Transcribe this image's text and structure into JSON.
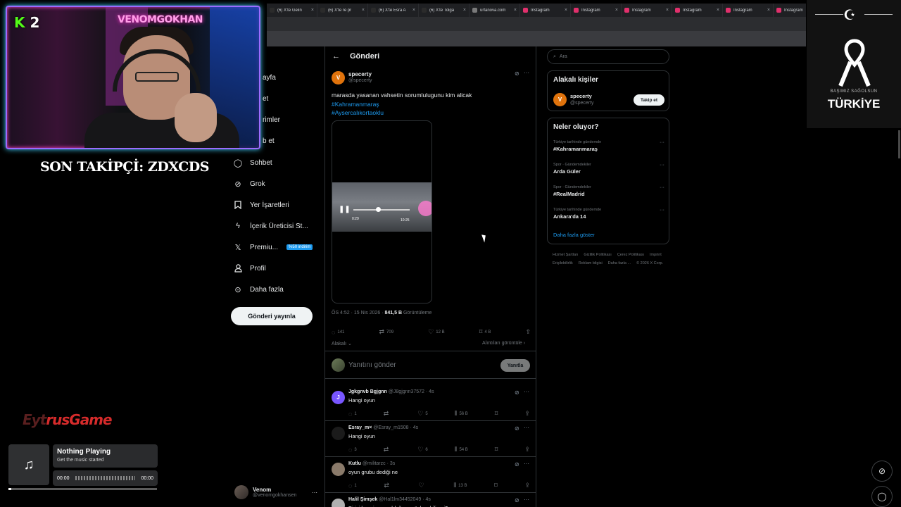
{
  "browser": {
    "tabs": [
      {
        "title": "(6) X'te Gelin",
        "color": "#2b2b2b"
      },
      {
        "title": "(6) X'te re pr",
        "color": "#2b2b2b"
      },
      {
        "title": "(6) X'te Esra A",
        "color": "#2b2b2b"
      },
      {
        "title": "(6) X'te Tolga",
        "color": "#2b2b2b"
      },
      {
        "title": "urfanova.com",
        "color": "#7a7a7a"
      },
      {
        "title": "Instagram",
        "color": "#e1306c"
      },
      {
        "title": "Instagram",
        "color": "#e1306c"
      },
      {
        "title": "Instagram",
        "color": "#e1306c"
      },
      {
        "title": "Instagram",
        "color": "#e1306c"
      },
      {
        "title": "Instagram",
        "color": "#e1306c"
      },
      {
        "title": "Instagram",
        "color": "#e1306c"
      }
    ]
  },
  "stream": {
    "cam_badge_k": "K",
    "cam_badge_num": "2",
    "cam_name": "VENOMGOKHAN",
    "last_follower": "SON TAKİPÇİ: ZDXCDS",
    "brand_logo_part1": "Eyt",
    "brand_logo_part2": "rusGame",
    "music": {
      "title": "Nothing Playing",
      "subtitle": "Get the music started",
      "time_current": "00:00",
      "time_total": "00:00",
      "progress": 0.02
    },
    "memorial": {
      "rip": "BAŞIMIZ SAĞOLSUN",
      "country": "TÜRKİYE"
    }
  },
  "nav": {
    "partial_items": [
      "ayfa",
      "et",
      "rimler",
      "b et"
    ],
    "items": [
      {
        "label": "Sohbet",
        "icon": "chat-icon"
      },
      {
        "label": "Grok",
        "icon": "grok-icon"
      },
      {
        "label": "Yer İşaretleri",
        "icon": "bookmark-icon"
      },
      {
        "label": "İçerik Üreticisi St...",
        "icon": "lightning-icon"
      },
      {
        "label": "Premiu...",
        "icon": "x-logo-icon"
      },
      {
        "label": "Profil",
        "icon": "person-icon"
      },
      {
        "label": "Daha fazla",
        "icon": "more-circle-icon"
      }
    ],
    "premium_badge": "%50 indirim",
    "post_button": "Gönderi yayınla",
    "account": {
      "name": "Venom",
      "handle": "@venomgokhansen"
    }
  },
  "main": {
    "title": "Gönderi",
    "tweet": {
      "avatar_letter": "V",
      "name": "specerty",
      "handle": "@specerty",
      "text": "marasda yasanan vahsetin sorumlulugunu kim alicak",
      "tags": [
        "#Kahramanmaraş",
        "#Aysercalıkortaoklu"
      ],
      "video_current": "0:29",
      "video_duration": "10:25",
      "time": "ÖS 4:52 · 15 Nis 2026 · ",
      "views_count": "841,5 B",
      "views_label": " Görüntüleme",
      "replies": "141",
      "reposts": "709",
      "likes": "12 B",
      "bookmarks": "4 B",
      "relevant": "Alakalı",
      "quotes": "Alıntıları görüntüle"
    },
    "reply_placeholder": "Yanıtını gönder",
    "reply_button": "Yanıtla",
    "comments": [
      {
        "avatar_letter": "J",
        "avatar_color": "#7856ff",
        "name": "Jgkgnvb Bgjgnn",
        "handle": "@J8gjgnn37572",
        "time": "4s",
        "text": "Hangi oyun",
        "replies": "1",
        "reposts": "",
        "likes": "5",
        "views": "56 B"
      },
      {
        "avatar_letter": "",
        "avatar_color": "#1b1b1b",
        "name": "Esray_m×",
        "handle": "@Esray_m1508",
        "time": "4s",
        "text": "Hangi oyun",
        "replies": "3",
        "reposts": "",
        "likes": "6",
        "views": "54 B"
      },
      {
        "avatar_letter": "",
        "avatar_color": "#8a7a6a",
        "name": "Kutlu",
        "handle": "@militarzc",
        "time": "3s",
        "text": "oyun grubu dediği ne",
        "replies": "1",
        "reposts": "",
        "likes": "",
        "views": "13 B"
      },
      {
        "avatar_letter": "",
        "avatar_color": "#b0b0b0",
        "name": "Halil Şimşek",
        "handle": "@Hal1lm34452049",
        "time": "4s",
        "text": "Birisi hangi oyun olduğunu söyleyebilir mi?",
        "replies": "",
        "reposts": "",
        "likes": "",
        "views": ""
      }
    ]
  },
  "sidebar_right": {
    "search_placeholder": "Ara",
    "people_title": "Alakalı kişiler",
    "person": {
      "avatar_letter": "V",
      "name": "specerty",
      "handle": "@specerty",
      "follow": "Takip et"
    },
    "trends_title": "Neler oluyor?",
    "trends": [
      {
        "context": "Türkiye tarihinde gündemde",
        "name": "#Kahramanmaraş"
      },
      {
        "context": "Spor · Gündemdekiler",
        "name": "Arda Güler"
      },
      {
        "context": "Spor · Gündemdekiler",
        "name": "#RealMadrid"
      },
      {
        "context": "Türkiye tarihinde gündemde",
        "name": "Ankara'da 14"
      }
    ],
    "show_more": "Daha fazla göster",
    "footer": [
      "Hizmet Şartları",
      "Gizlilik Politikası",
      "Çerez Politikası",
      "Imprint",
      "Erişilebilirlik",
      "Reklam bilgisi",
      "Daha fazla ...",
      "© 2026 X Corp."
    ]
  },
  "colors": {
    "accent": "#1d9bf0",
    "background": "#000000",
    "border": "#2f3336",
    "kick_green": "#53fc18"
  }
}
